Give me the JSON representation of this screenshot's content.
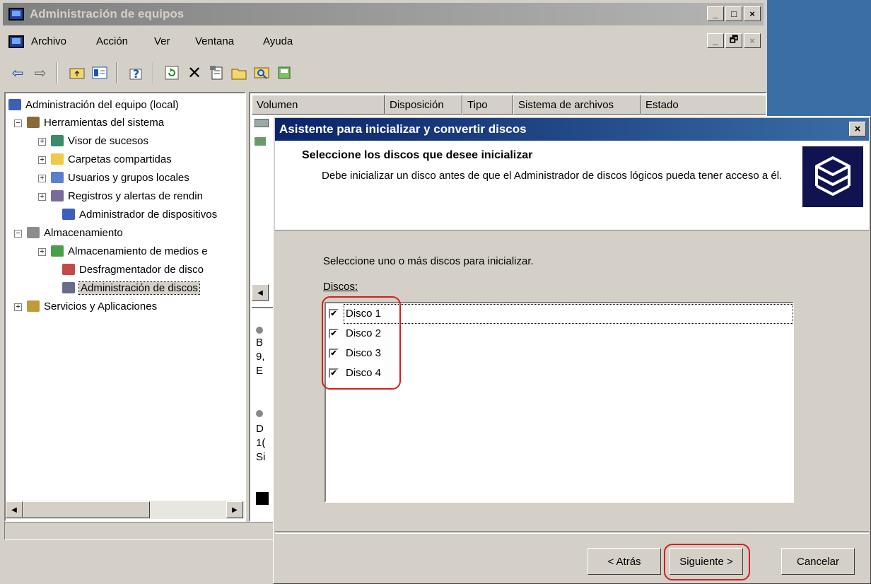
{
  "main_window": {
    "title": "Administración de equipos",
    "caption_buttons": {
      "minimize": "_",
      "maximize": "□",
      "close": "×"
    },
    "mdi_buttons": {
      "minimize": "_",
      "restore": "🗗",
      "close": "×"
    }
  },
  "menu": [
    "Archivo",
    "Acción",
    "Ver",
    "Ventana",
    "Ayuda"
  ],
  "toolbar_icons": [
    "back-arrow-icon",
    "forward-arrow-icon",
    "up-folder-icon",
    "show-hide-tree-icon",
    "help-icon",
    "refresh-icon",
    "delete-icon",
    "properties-icon",
    "open-icon",
    "find-icon",
    "disk-icon"
  ],
  "tree": {
    "root": "Administración del equipo (local)",
    "items": [
      "Herramientas del sistema",
      "Visor de sucesos",
      "Carpetas compartidas",
      "Usuarios y grupos locales",
      "Registros y alertas de rendin",
      "Administrador de dispositivos",
      "Almacenamiento",
      "Almacenamiento de medios e",
      "Desfragmentador de disco",
      "Administración de discos",
      "Servicios y Aplicaciones"
    ]
  },
  "list": {
    "columns": [
      "Volumen",
      "Disposición",
      "Tipo",
      "Sistema de archivos",
      "Estado"
    ],
    "fragments": [
      "B",
      "9,",
      "E",
      "D",
      "1(",
      "Si"
    ]
  },
  "wizard": {
    "title": "Asistente para inicializar y convertir discos",
    "close": "×",
    "heading": "Seleccione los discos que desee inicializar",
    "subheading": "Debe inicializar un disco antes de que el Administrador de discos lógicos pueda tener acceso a él.",
    "instruction": "Seleccione uno o más discos para inicializar.",
    "discos_label": "Discos:",
    "disks": [
      {
        "label": "Disco 1",
        "checked": true
      },
      {
        "label": "Disco 2",
        "checked": true
      },
      {
        "label": "Disco 3",
        "checked": true
      },
      {
        "label": "Disco 4",
        "checked": true
      }
    ],
    "buttons": {
      "back": "< Atrás",
      "next": "Siguiente >",
      "cancel": "Cancelar"
    }
  },
  "colors": {
    "annotation_red": "#d21f1f",
    "active_title": "#0a246a",
    "inactive_title": "#808080"
  }
}
